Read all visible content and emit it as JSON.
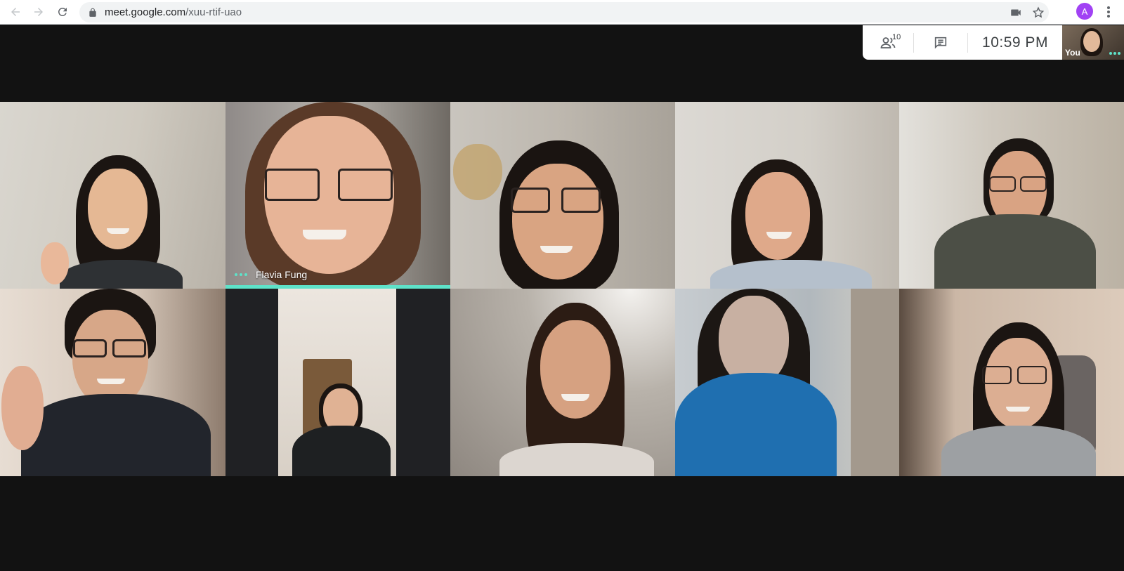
{
  "browser": {
    "url_host": "meet.google.com",
    "url_path": "/xuu-rtif-uao",
    "profile_initial": "A"
  },
  "meet": {
    "participant_count": "10",
    "time": "10:59  PM",
    "self_label": "You"
  },
  "tiles": [
    {
      "name": ""
    },
    {
      "name": "Flavia Fung",
      "speaking": true
    },
    {
      "name": ""
    },
    {
      "name": ""
    },
    {
      "name": ""
    },
    {
      "name": ""
    },
    {
      "name": ""
    },
    {
      "name": ""
    },
    {
      "name": ""
    },
    {
      "name": ""
    }
  ],
  "colors": {
    "speaking_accent": "#5ee2c9",
    "meet_background": "#121212",
    "profile_avatar": "#a142f4"
  }
}
